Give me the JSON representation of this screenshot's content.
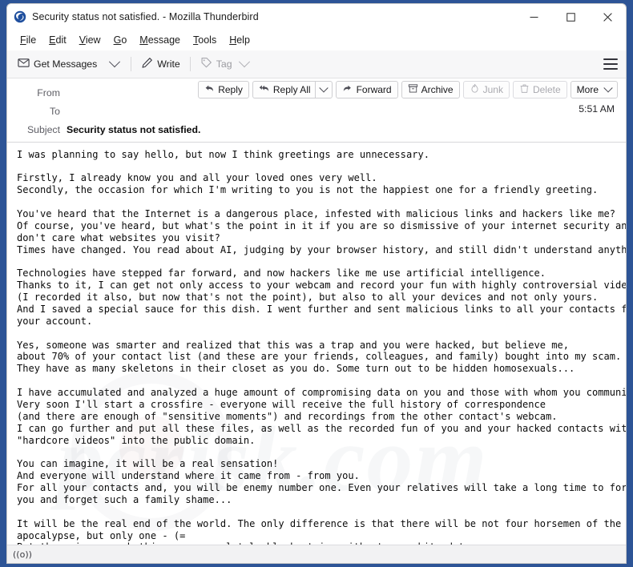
{
  "window": {
    "title": "Security status not satisfied. - Mozilla Thunderbird",
    "logo_icon": "thunderbird-logo-icon",
    "controls": {
      "minimize": "minimize-icon",
      "maximize": "maximize-icon",
      "close": "close-icon"
    }
  },
  "menubar": {
    "items": [
      {
        "label": "File",
        "accel": "F"
      },
      {
        "label": "Edit",
        "accel": "E"
      },
      {
        "label": "View",
        "accel": "V"
      },
      {
        "label": "Go",
        "accel": "G"
      },
      {
        "label": "Message",
        "accel": "M"
      },
      {
        "label": "Tools",
        "accel": "T"
      },
      {
        "label": "Help",
        "accel": "H"
      }
    ]
  },
  "toolbar": {
    "get_messages": "Get Messages",
    "get_messages_icon": "inbox-download-icon",
    "get_messages_chevron": "chevron-down-icon",
    "write": "Write",
    "write_icon": "pencil-icon",
    "tag": "Tag",
    "tag_icon": "tag-icon",
    "tag_chevron": "chevron-down-icon",
    "app_menu_icon": "hamburger-menu-icon"
  },
  "header": {
    "from_label": "From",
    "from_value": "",
    "to_label": "To",
    "to_value": "",
    "subject_label": "Subject",
    "subject_value": "Security status not satisfied.",
    "date": "5:51 AM"
  },
  "message_actions": [
    {
      "label": "Reply",
      "icon": "reply-arrow-icon",
      "enabled": true,
      "has_menu": false
    },
    {
      "label": "Reply All",
      "icon": "reply-all-arrow-icon",
      "enabled": true,
      "has_menu": true
    },
    {
      "label": "Forward",
      "icon": "forward-arrow-icon",
      "enabled": true,
      "has_menu": false
    },
    {
      "label": "Archive",
      "icon": "archive-box-icon",
      "enabled": true,
      "has_menu": false
    },
    {
      "label": "Junk",
      "icon": "junk-flame-icon",
      "enabled": false,
      "has_menu": false
    },
    {
      "label": "Delete",
      "icon": "trash-can-icon",
      "enabled": false,
      "has_menu": false
    },
    {
      "label": "More",
      "icon": "",
      "enabled": true,
      "has_menu": true
    }
  ],
  "message_body": "I was planning to say hello, but now I think greetings are unnecessary.\n\nFirstly, I already know you and all your loved ones very well.\nSecondly, the occasion for which I'm writing to you is not the happiest one for a friendly greeting.\n\nYou've heard that the Internet is a dangerous place, infested with malicious links and hackers like me?\nOf course, you've heard, but what's the point in it if you are so dismissive of your internet security and\ndon't care what websites you visit?\nTimes have changed. You read about AI, judging by your browser history, and still didn't understand anything?\n\nTechnologies have stepped far forward, and now hackers like me use artificial intelligence.\nThanks to it, I can get not only access to your webcam and record your fun with highly controversial video\n(I recorded it also, but now that's not the point), but also to all your devices and not only yours.\nAnd I saved a special sauce for this dish. I went further and sent malicious links to all your contacts from\nyour account.\n\nYes, someone was smarter and realized that this was a trap and you were hacked, but believe me,\nabout 70% of your contact list (and these are your friends, colleagues, and family) bought into my scam.\nThey have as many skeletons in their closet as you do. Some turn out to be hidden homosexuals...\n\nI have accumulated and analyzed a huge amount of compromising data on you and those with whom you communicate.\nVery soon I'll start a crossfire - everyone will receive the full history of correspondence\n(and there are enough of \"sensitive moments\") and recordings from the other contact's webcam.\nI can go further and put all these files, as well as the recorded fun of you and your hacked contacts with\n\"hardcore videos\" into the public domain.\n\nYou can imagine, it will be a real sensation!\nAnd everyone will understand where it came from - from you.\nFor all your contacts and, you will be enemy number one. Even your relatives will take a long time to forgive\nyou and forget such a family shame...\n\nIt will be the real end of the world. The only difference is that there will be not four horsemen of the\napocalypse, but only one - (=\nBut there is no such thing as a completely black stripe without any white dots.\nLuckily for you, in my case the \"Three M Rule\" comes into play - Money, Money and Money again.",
  "statusbar": {
    "icon": "((o))",
    "icon_name": "network-activity-icon"
  },
  "watermark": {
    "text": "pcrisk.com"
  },
  "colors": {
    "frame_blue": "#2d5496",
    "toolbar_bg": "#f7f7f8",
    "statusbar_bg": "#f2f2f3",
    "text": "#0a0a0a",
    "label_grey": "#5d5d64",
    "disabled_grey": "#a9a9af"
  }
}
